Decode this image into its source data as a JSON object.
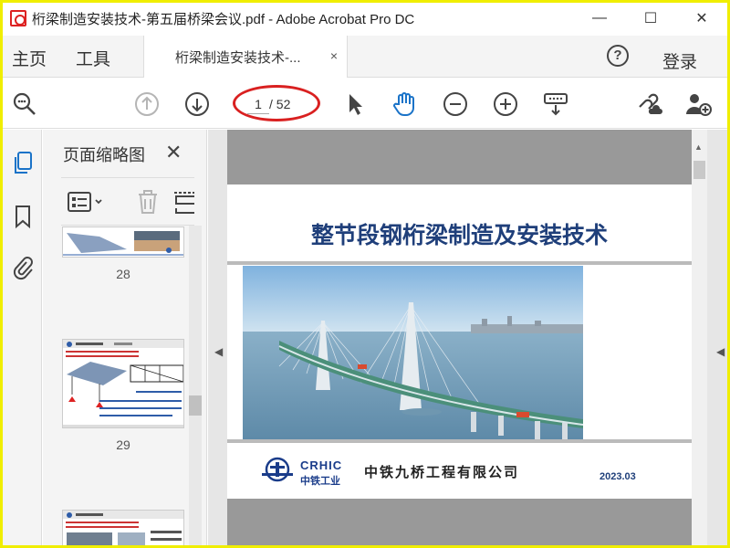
{
  "window": {
    "title": "桁梁制造安装技术-第五届桥梁会议.pdf - Adobe Acrobat Pro DC",
    "controls": {
      "minimize": "—",
      "maximize": "☐",
      "close": "✕"
    }
  },
  "menu": {
    "home": "主页",
    "tools": "工具",
    "tab_label": "桁梁制造安装技术-...",
    "tab_close": "×",
    "help": "?",
    "login": "登录"
  },
  "toolbar": {
    "page_current": "1",
    "page_total": "/ 52",
    "icons": [
      "search-zoom-icon",
      "prev-page-icon",
      "next-page-icon",
      "select-arrow-icon",
      "hand-tool-icon",
      "zoom-out-icon",
      "zoom-in-icon",
      "marquee-zoom-icon",
      "share-link-icon",
      "add-user-icon"
    ]
  },
  "thumbnails": {
    "title": "页面缩略图",
    "close": "✕",
    "pages": [
      {
        "number": "28"
      },
      {
        "number": "29"
      },
      {
        "number": ""
      }
    ]
  },
  "document": {
    "title": "整节段钢桁梁制造及安装技术",
    "logo_text_en": "CRHIC",
    "logo_text_cn": "中铁工业",
    "company": "中铁九桥工程有限公司",
    "date": "2023.03"
  },
  "colors": {
    "accent_blue": "#1f3f7a",
    "annotation_red": "#d92020",
    "hand_tool_blue": "#1a73c8"
  }
}
